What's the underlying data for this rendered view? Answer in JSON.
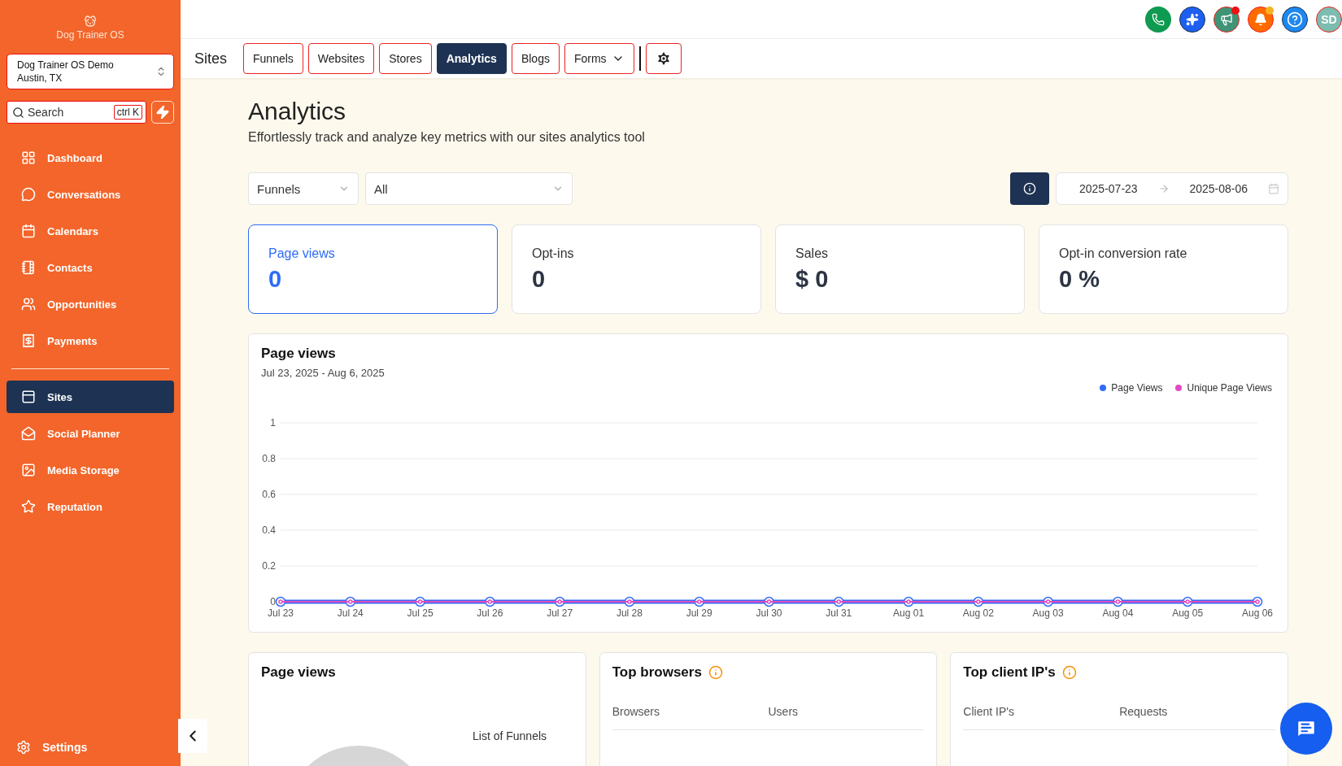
{
  "sidebar": {
    "brand": "Dog Trainer OS",
    "account": {
      "name": "Dog Trainer OS Demo",
      "location": "Austin, TX"
    },
    "search": {
      "placeholder": "Search",
      "shortcut": "ctrl K"
    },
    "sections": [
      {
        "items": [
          {
            "label": "Dashboard",
            "selected": false
          },
          {
            "label": "Conversations",
            "selected": false
          },
          {
            "label": "Calendars",
            "selected": false
          },
          {
            "label": "Contacts",
            "selected": false
          },
          {
            "label": "Opportunities",
            "selected": false
          },
          {
            "label": "Payments",
            "selected": false
          }
        ]
      },
      {
        "items": [
          {
            "label": "Sites",
            "selected": true
          },
          {
            "label": "Social Planner",
            "selected": false
          },
          {
            "label": "Media Storage",
            "selected": false
          },
          {
            "label": "Reputation",
            "selected": false
          }
        ]
      }
    ],
    "footer": {
      "label": "Settings"
    }
  },
  "top_icons": [
    {
      "kind": "phone",
      "notification": false
    },
    {
      "kind": "sparkle",
      "notification": false
    },
    {
      "kind": "megaphone",
      "notification": true,
      "color": "#ee1111"
    },
    {
      "kind": "bell",
      "notification": true,
      "color": "#f5b324"
    },
    {
      "kind": "help",
      "notification": false
    },
    {
      "kind": "avatar",
      "initials": "SD",
      "notification": false
    }
  ],
  "section_title": "Sites",
  "tabs": [
    {
      "kind": "tab",
      "label": "Funnels",
      "selected": false
    },
    {
      "kind": "tab",
      "label": "Websites",
      "selected": false
    },
    {
      "kind": "tab",
      "label": "Stores",
      "selected": false
    },
    {
      "kind": "tab",
      "label": "Analytics",
      "selected": true
    },
    {
      "kind": "tab",
      "label": "Blogs",
      "selected": false
    },
    {
      "kind": "dropdown",
      "label": "Forms",
      "selected": false
    },
    {
      "kind": "settings",
      "selected": false
    }
  ],
  "page": {
    "title": "Analytics",
    "subtitle": "Effortlessly track and analyze key metrics with our sites analytics tool"
  },
  "filters": {
    "type": "Funnels",
    "item": "All",
    "start_date": "2025-07-23",
    "end_date": "2025-08-06"
  },
  "metrics": [
    {
      "label": "Page views",
      "value": "0",
      "selected": true
    },
    {
      "label": "Opt-ins",
      "value": "0",
      "selected": false
    },
    {
      "label": "Sales",
      "value": "$ 0",
      "selected": false
    },
    {
      "label": "Opt-in conversion rate",
      "value": "0 %",
      "selected": false
    }
  ],
  "chart_card": {
    "title": "Page views",
    "range": "Jul 23, 2025 - Aug 6, 2025",
    "chart_data": {
      "type": "line",
      "grid": true,
      "categories": [
        "Jul 23",
        "Jul 24",
        "Jul 25",
        "Jul 26",
        "Jul 27",
        "Jul 28",
        "Jul 29",
        "Jul 30",
        "Jul 31",
        "Aug 01",
        "Aug 02",
        "Aug 03",
        "Aug 04",
        "Aug 05",
        "Aug 06"
      ],
      "ylim": [
        0,
        1
      ],
      "yticks": [
        0,
        0.2,
        0.4,
        0.6,
        0.8,
        1
      ],
      "series": [
        {
          "name": "Page Views",
          "color": "#2f6cf6",
          "marker": "circle",
          "values": [
            0,
            0,
            0,
            0,
            0,
            0,
            0,
            0,
            0,
            0,
            0,
            0,
            0,
            0,
            0
          ]
        },
        {
          "name": "Unique Page Views",
          "color": "#e44bbf",
          "marker": "circle",
          "values": [
            0,
            0,
            0,
            0,
            0,
            0,
            0,
            0,
            0,
            0,
            0,
            0,
            0,
            0,
            0
          ]
        }
      ]
    }
  },
  "bottom_cards": [
    {
      "kind": "pie",
      "title": "Page views",
      "info": false,
      "legend_title": "List of Funnels"
    },
    {
      "kind": "table",
      "title": "Top browsers",
      "info": true,
      "columns": [
        "Browsers",
        "Users"
      ]
    },
    {
      "kind": "table",
      "title": "Top client IP's",
      "info": true,
      "columns": [
        "Client IP's",
        "Requests"
      ]
    }
  ]
}
